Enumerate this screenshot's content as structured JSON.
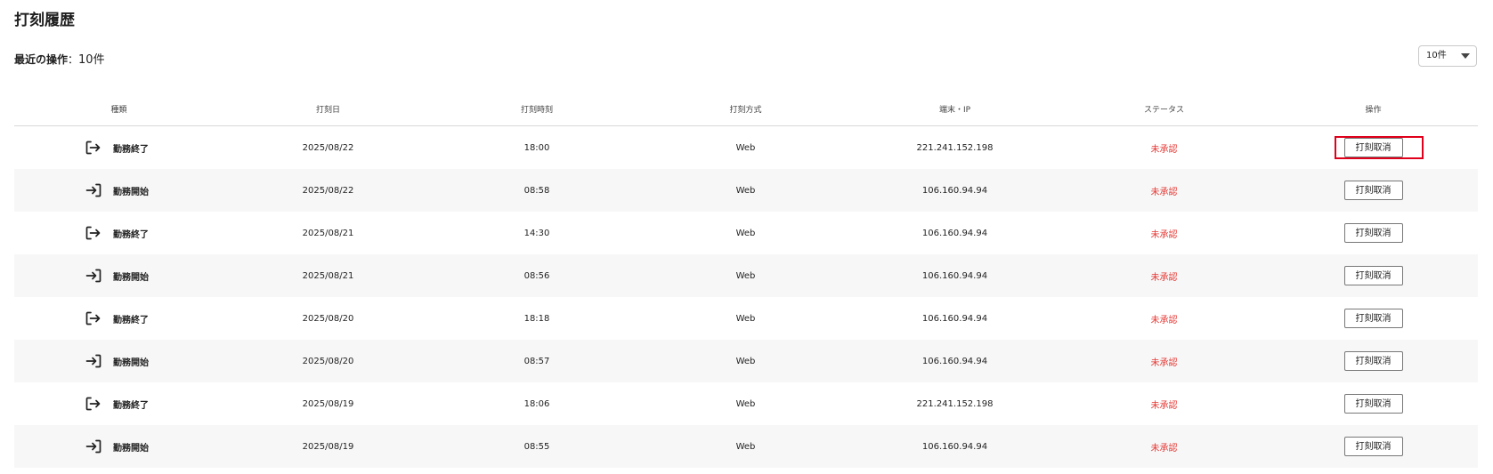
{
  "page": {
    "title": "打刻履歴",
    "recent_label": "最近の操作",
    "recent_sep": "：",
    "recent_count": "10件"
  },
  "page_size_select": {
    "value": "10件"
  },
  "table": {
    "headers": [
      "種類",
      "打刻日",
      "打刻時刻",
      "打刻方式",
      "端末・IP",
      "ステータス",
      "操作"
    ],
    "rows": [
      {
        "icon": "exit-icon",
        "type": "勤務終了",
        "date": "2025/08/22",
        "time": "18:00",
        "method": "Web",
        "ip": "221.241.152.198",
        "status": "未承認",
        "action": "打刻取消"
      },
      {
        "icon": "enter-icon",
        "type": "勤務開始",
        "date": "2025/08/22",
        "time": "08:58",
        "method": "Web",
        "ip": "106.160.94.94",
        "status": "未承認",
        "action": "打刻取消"
      },
      {
        "icon": "exit-icon",
        "type": "勤務終了",
        "date": "2025/08/21",
        "time": "14:30",
        "method": "Web",
        "ip": "106.160.94.94",
        "status": "未承認",
        "action": "打刻取消"
      },
      {
        "icon": "enter-icon",
        "type": "勤務開始",
        "date": "2025/08/21",
        "time": "08:56",
        "method": "Web",
        "ip": "106.160.94.94",
        "status": "未承認",
        "action": "打刻取消"
      },
      {
        "icon": "exit-icon",
        "type": "勤務終了",
        "date": "2025/08/20",
        "time": "18:18",
        "method": "Web",
        "ip": "106.160.94.94",
        "status": "未承認",
        "action": "打刻取消"
      },
      {
        "icon": "enter-icon",
        "type": "勤務開始",
        "date": "2025/08/20",
        "time": "08:57",
        "method": "Web",
        "ip": "106.160.94.94",
        "status": "未承認",
        "action": "打刻取消"
      },
      {
        "icon": "exit-icon",
        "type": "勤務終了",
        "date": "2025/08/19",
        "time": "18:06",
        "method": "Web",
        "ip": "221.241.152.198",
        "status": "未承認",
        "action": "打刻取消"
      },
      {
        "icon": "enter-icon",
        "type": "勤務開始",
        "date": "2025/08/19",
        "time": "08:55",
        "method": "Web",
        "ip": "106.160.94.94",
        "status": "未承認",
        "action": "打刻取消"
      }
    ]
  },
  "colors": {
    "status_unapproved": "#e53935",
    "highlight": "#e0001b",
    "row_alt": "#f7f7f7"
  }
}
